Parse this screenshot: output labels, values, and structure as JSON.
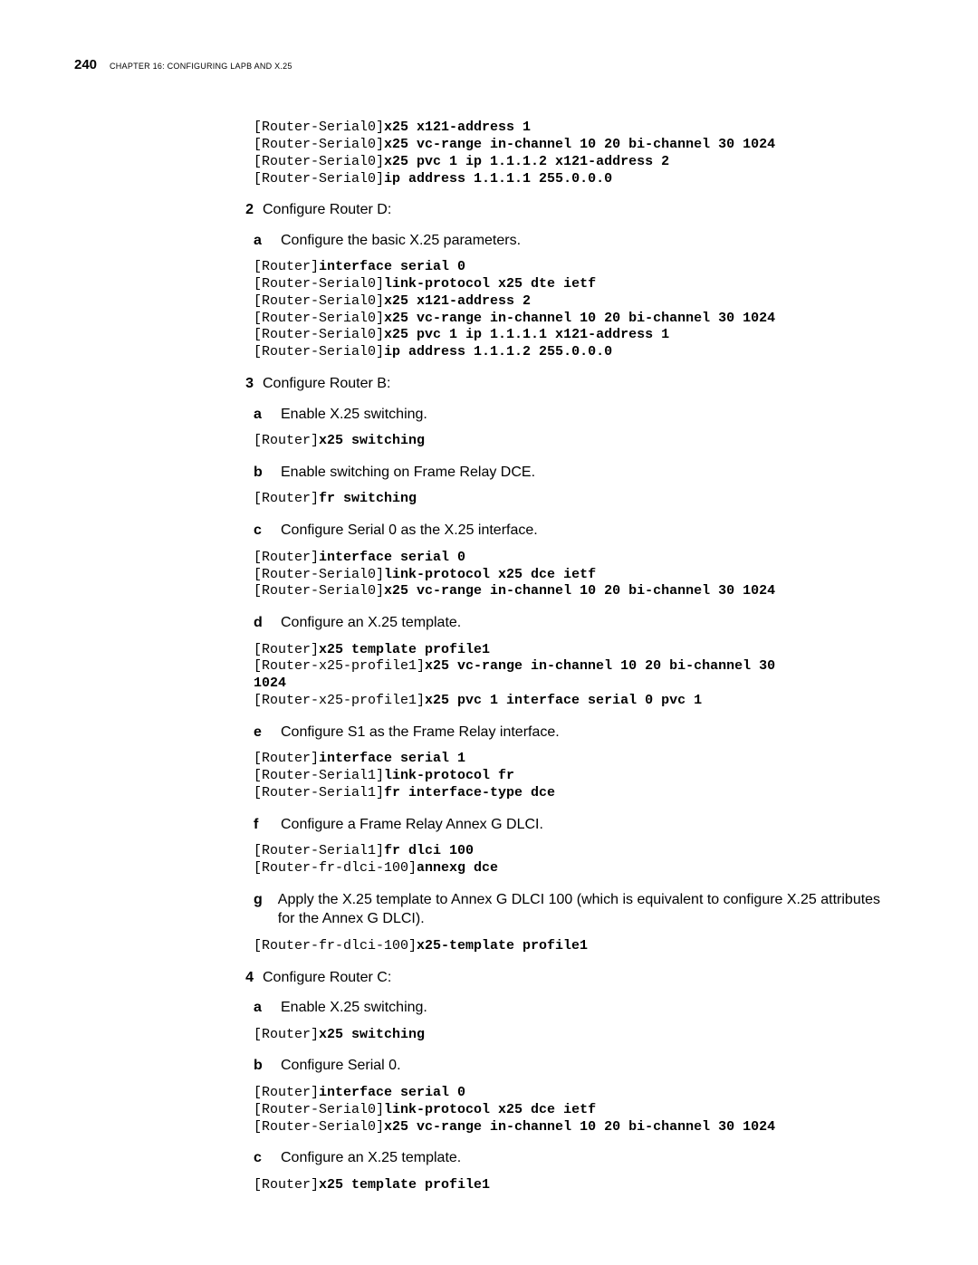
{
  "header": {
    "page_number": "240",
    "chapter_label": "CHAPTER 16: CONFIGURING LAPB AND X.25"
  },
  "blocks": [
    {
      "type": "code",
      "lines": [
        {
          "prompt": "[Router-Serial0]",
          "cmd": "x25 x121-address 1"
        },
        {
          "prompt": "[Router-Serial0]",
          "cmd": "x25 vc-range in-channel 10 20 bi-channel 30 1024"
        },
        {
          "prompt": "[Router-Serial0]",
          "cmd": "x25 pvc 1 ip 1.1.1.2 x121-address 2"
        },
        {
          "prompt": "[Router-Serial0]",
          "cmd": "ip address 1.1.1.1 255.0.0.0"
        }
      ]
    },
    {
      "type": "num",
      "num": "2",
      "text": "Configure Router D:"
    },
    {
      "type": "letter",
      "letter": "a",
      "text": "Configure the basic X.25 parameters."
    },
    {
      "type": "code",
      "lines": [
        {
          "prompt": "[Router]",
          "cmd": "interface serial 0"
        },
        {
          "prompt": "[Router-Serial0]",
          "cmd": "link-protocol x25 dte ietf"
        },
        {
          "prompt": "[Router-Serial0]",
          "cmd": "x25 x121-address 2"
        },
        {
          "prompt": "[Router-Serial0]",
          "cmd": "x25 vc-range in-channel 10 20 bi-channel 30 1024"
        },
        {
          "prompt": "[Router-Serial0]",
          "cmd": "x25 pvc 1 ip 1.1.1.1 x121-address 1"
        },
        {
          "prompt": "[Router-Serial0]",
          "cmd": "ip address 1.1.1.2 255.0.0.0"
        }
      ]
    },
    {
      "type": "num",
      "num": "3",
      "text": "Configure Router B:"
    },
    {
      "type": "letter",
      "letter": "a",
      "text": "Enable X.25 switching."
    },
    {
      "type": "code",
      "lines": [
        {
          "prompt": "[Router]",
          "cmd": "x25 switching"
        }
      ]
    },
    {
      "type": "letter",
      "letter": "b",
      "text": "Enable switching on Frame Relay DCE."
    },
    {
      "type": "code",
      "lines": [
        {
          "prompt": "[Router]",
          "cmd": "fr switching"
        }
      ]
    },
    {
      "type": "letter",
      "letter": "c",
      "text": "Configure Serial 0 as the X.25 interface."
    },
    {
      "type": "code",
      "lines": [
        {
          "prompt": "[Router]",
          "cmd": "interface serial 0"
        },
        {
          "prompt": "[Router-Serial0]",
          "cmd": "link-protocol x25 dce ietf"
        },
        {
          "prompt": "[Router-Serial0]",
          "cmd": "x25 vc-range in-channel 10 20 bi-channel 30 1024"
        }
      ]
    },
    {
      "type": "letter",
      "letter": "d",
      "text": "Configure an X.25 template."
    },
    {
      "type": "code",
      "lines": [
        {
          "prompt": "[Router]",
          "cmd": "x25 template profile1"
        },
        {
          "prompt": "[Router-x25-profile1]",
          "cmd": "x25 vc-range in-channel 10 20 bi-channel 30 "
        },
        {
          "prompt": "",
          "cmd": "1024"
        },
        {
          "prompt": "[Router-x25-profile1]",
          "cmd": "x25 pvc 1 interface serial 0 pvc 1"
        }
      ]
    },
    {
      "type": "letter",
      "letter": "e",
      "text": "Configure S1 as the Frame Relay interface."
    },
    {
      "type": "code",
      "lines": [
        {
          "prompt": "[Router]",
          "cmd": "interface serial 1"
        },
        {
          "prompt": "[Router-Serial1]",
          "cmd": "link-protocol fr"
        },
        {
          "prompt": "[Router-Serial1]",
          "cmd": "fr interface-type dce"
        }
      ]
    },
    {
      "type": "letter",
      "letter": "f",
      "text": "Configure a Frame Relay Annex G DLCI."
    },
    {
      "type": "code",
      "lines": [
        {
          "prompt": "[Router-Serial1]",
          "cmd": "fr dlci 100"
        },
        {
          "prompt": "[Router-fr-dlci-100]",
          "cmd": "annexg dce"
        }
      ]
    },
    {
      "type": "letter",
      "letter": "g",
      "text": "Apply the X.25 template to Annex G DLCI 100 (which is equivalent to configure X.25 attributes for the Annex G DLCI)."
    },
    {
      "type": "code",
      "lines": [
        {
          "prompt": "[Router-fr-dlci-100]",
          "cmd": "x25-template profile1"
        }
      ]
    },
    {
      "type": "num",
      "num": "4",
      "text": "Configure Router C:"
    },
    {
      "type": "letter",
      "letter": "a",
      "text": "Enable X.25 switching."
    },
    {
      "type": "code",
      "lines": [
        {
          "prompt": "[Router]",
          "cmd": "x25 switching"
        }
      ]
    },
    {
      "type": "letter",
      "letter": "b",
      "text": "Configure Serial 0."
    },
    {
      "type": "code",
      "lines": [
        {
          "prompt": "[Router]",
          "cmd": "interface serial 0"
        },
        {
          "prompt": "[Router-Serial0]",
          "cmd": "link-protocol x25 dce ietf"
        },
        {
          "prompt": "[Router-Serial0]",
          "cmd": "x25 vc-range in-channel 10 20 bi-channel 30 1024"
        }
      ]
    },
    {
      "type": "letter",
      "letter": "c",
      "text": "Configure an X.25 template."
    },
    {
      "type": "code",
      "lines": [
        {
          "prompt": "[Router]",
          "cmd": "x25 template profile1"
        }
      ]
    }
  ]
}
